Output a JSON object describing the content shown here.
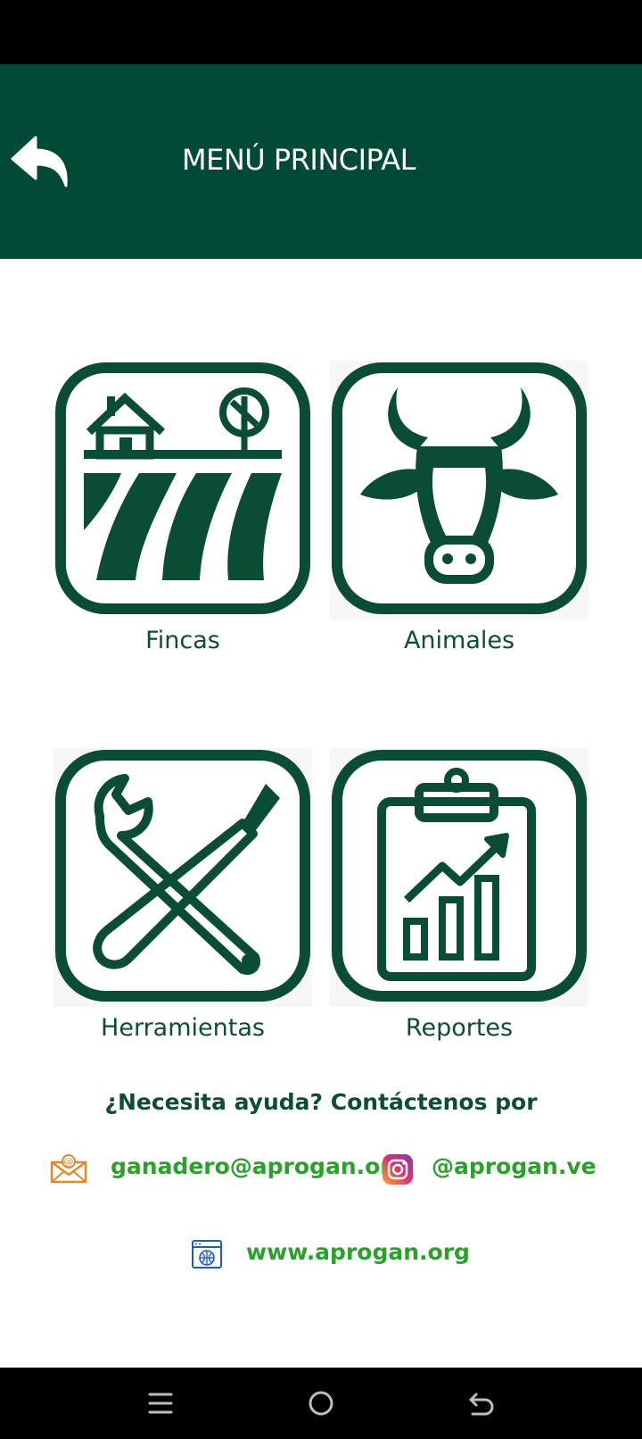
{
  "header": {
    "title": "MENÚ PRINCIPAL",
    "background": "#014a33",
    "back_icon": "back-arrow-icon"
  },
  "menu": {
    "accent": "#0b4d34",
    "items": [
      {
        "label": "Fincas",
        "icon": "farm-icon"
      },
      {
        "label": "Animales",
        "icon": "cow-icon"
      },
      {
        "label": "Herramientas",
        "icon": "tools-icon"
      },
      {
        "label": "Reportes",
        "icon": "report-chart-icon"
      }
    ]
  },
  "help": {
    "text": "¿Necesita ayuda? Contáctenos por",
    "email": "ganadero@aprogan.org",
    "instagram": "@aprogan.ve",
    "website": "www.aprogan.org",
    "link_color": "#2ba12b"
  },
  "system_nav": {
    "recents_icon": "menu-lines-icon",
    "home_icon": "home-circle-icon",
    "back_icon": "system-back-icon"
  }
}
